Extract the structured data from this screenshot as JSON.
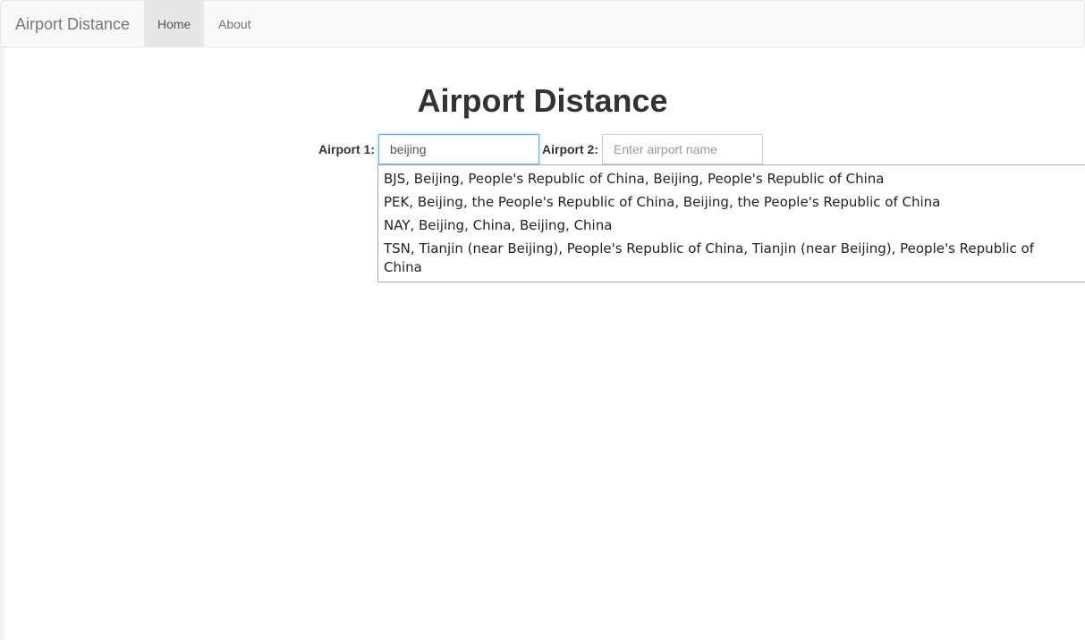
{
  "navbar": {
    "brand": "Airport Distance",
    "items": [
      {
        "label": "Home",
        "active": true
      },
      {
        "label": "About",
        "active": false
      }
    ]
  },
  "page": {
    "title": "Airport Distance"
  },
  "form": {
    "airport1": {
      "label": "Airport 1:",
      "value": "beijing"
    },
    "airport2": {
      "label": "Airport 2:",
      "value": "",
      "placeholder": "Enter airport name"
    }
  },
  "autocomplete": {
    "suggestions": [
      "BJS, Beijing, People's Republic of China, Beijing, People's Republic of China",
      "PEK, Beijing, the People's Republic of China, Beijing, the People's Republic of China",
      "NAY, Beijing, China, Beijing, China",
      "TSN, Tianjin (near Beijing), People's Republic of China, Tianjin (near Beijing), People's Republic of China"
    ]
  },
  "colors": {
    "navbar_bg": "#f8f8f8",
    "active_nav_bg": "#e7e7e7",
    "focus_border": "#66afe9"
  }
}
